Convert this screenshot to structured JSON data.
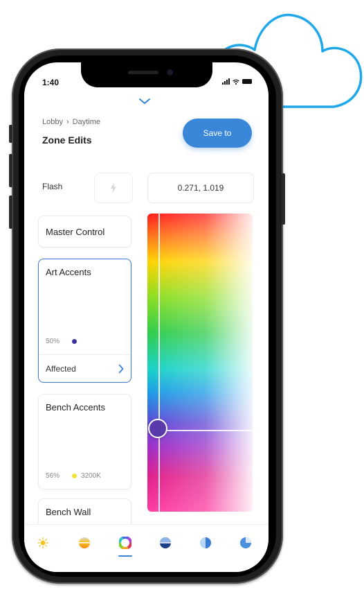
{
  "status_bar": {
    "time": "1:40"
  },
  "header": {
    "breadcrumb": {
      "parent": "Lobby",
      "separator": "›",
      "current": "Daytime"
    },
    "title": "Zone Edits",
    "save_label": "Save to"
  },
  "flash": {
    "label": "Flash",
    "coordinates": "0.271, 1.019"
  },
  "zones": {
    "master": {
      "label": "Master Control"
    },
    "art_accents": {
      "label": "Art Accents",
      "level": "50%",
      "dot_color": "#3b2fa0",
      "affected_label": "Affected"
    },
    "bench_accents": {
      "label": "Bench Accents",
      "level": "56%",
      "temperature": "3200K",
      "dot_color": "#f5e13b"
    },
    "bench_wall": {
      "label": "Bench Wall"
    }
  },
  "tabs": [
    {
      "name": "brightness",
      "icon": "sun-icon",
      "active": false
    },
    {
      "name": "gradient",
      "icon": "gradient-circle-icon",
      "active": false
    },
    {
      "name": "color",
      "icon": "color-wheel-icon",
      "active": true
    },
    {
      "name": "horizon",
      "icon": "horizon-circle-icon",
      "active": false
    },
    {
      "name": "shade",
      "icon": "half-circle-icon",
      "active": false
    },
    {
      "name": "timer",
      "icon": "pie-timer-icon",
      "active": false
    }
  ],
  "colors": {
    "accent": "#3a86d8",
    "selected_color": "#5a3aa8"
  }
}
